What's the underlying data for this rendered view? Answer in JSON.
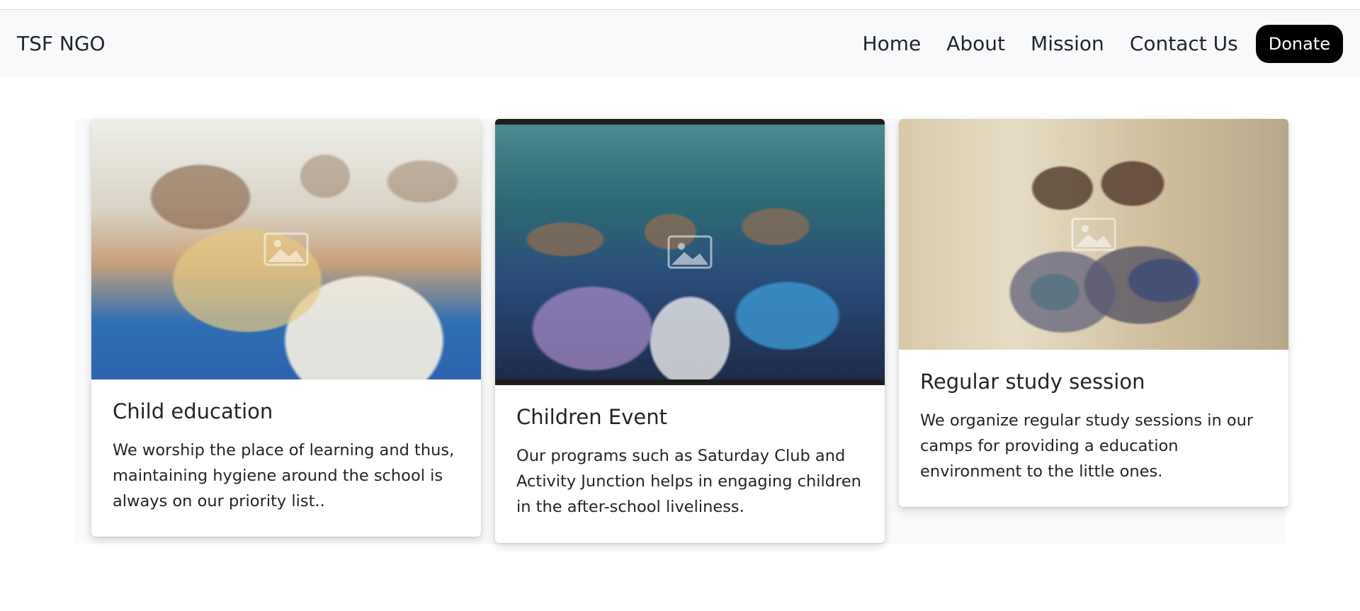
{
  "navbar": {
    "brand": "TSF NGO",
    "links": [
      {
        "label": "Home"
      },
      {
        "label": "About"
      },
      {
        "label": "Mission"
      },
      {
        "label": "Contact Us"
      }
    ],
    "donate_label": "Donate"
  },
  "cards": [
    {
      "title": "Child education",
      "text": "We worship the place of learning and thus, maintaining hygiene around the school is always on our priority list..",
      "image_icon": "photo-icon"
    },
    {
      "title": "Children Event",
      "text": "Our programs such as Saturday Club and Activity Junction helps in engaging children in the after-school liveliness.",
      "image_icon": "photo-icon"
    },
    {
      "title": "Regular study session",
      "text": "We organize regular study sessions in our camps for providing a education environment to the little ones.",
      "image_icon": "photo-icon"
    }
  ],
  "colors": {
    "navbar_bg": "#f8f9fa",
    "donate_bg": "#000000",
    "text": "#212529"
  }
}
